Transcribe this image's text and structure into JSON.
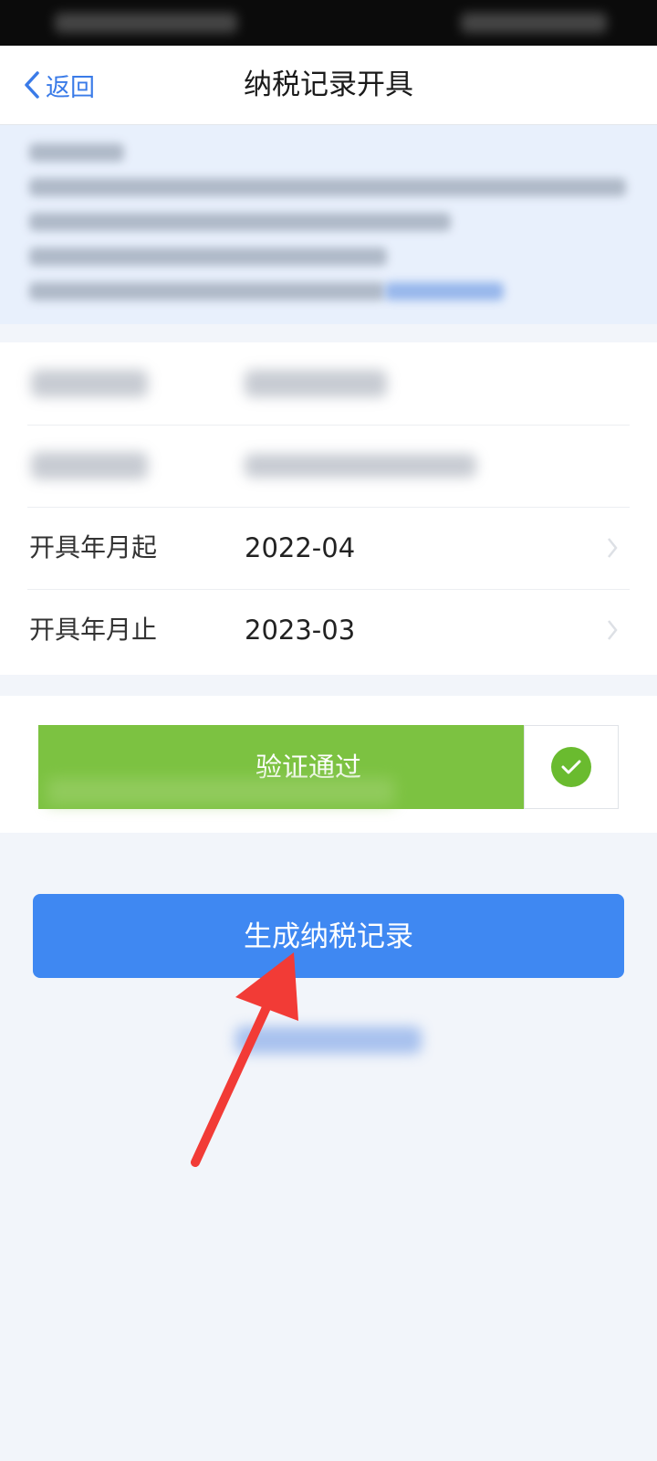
{
  "nav": {
    "back_label": "返回",
    "title": "纳税记录开具"
  },
  "form": {
    "start_label": "开具年月起",
    "start_value": "2022-04",
    "end_label": "开具年月止",
    "end_value": "2023-03"
  },
  "verify": {
    "label": "验证通过"
  },
  "actions": {
    "generate_label": "生成纳税记录"
  },
  "colors": {
    "accent": "#3f88f2",
    "success": "#7cc241",
    "annotation": "#f23b36"
  },
  "icons": {
    "back": "chevron-left-icon",
    "verified": "check-circle-icon",
    "row_chevron": "chevron-right-icon"
  }
}
